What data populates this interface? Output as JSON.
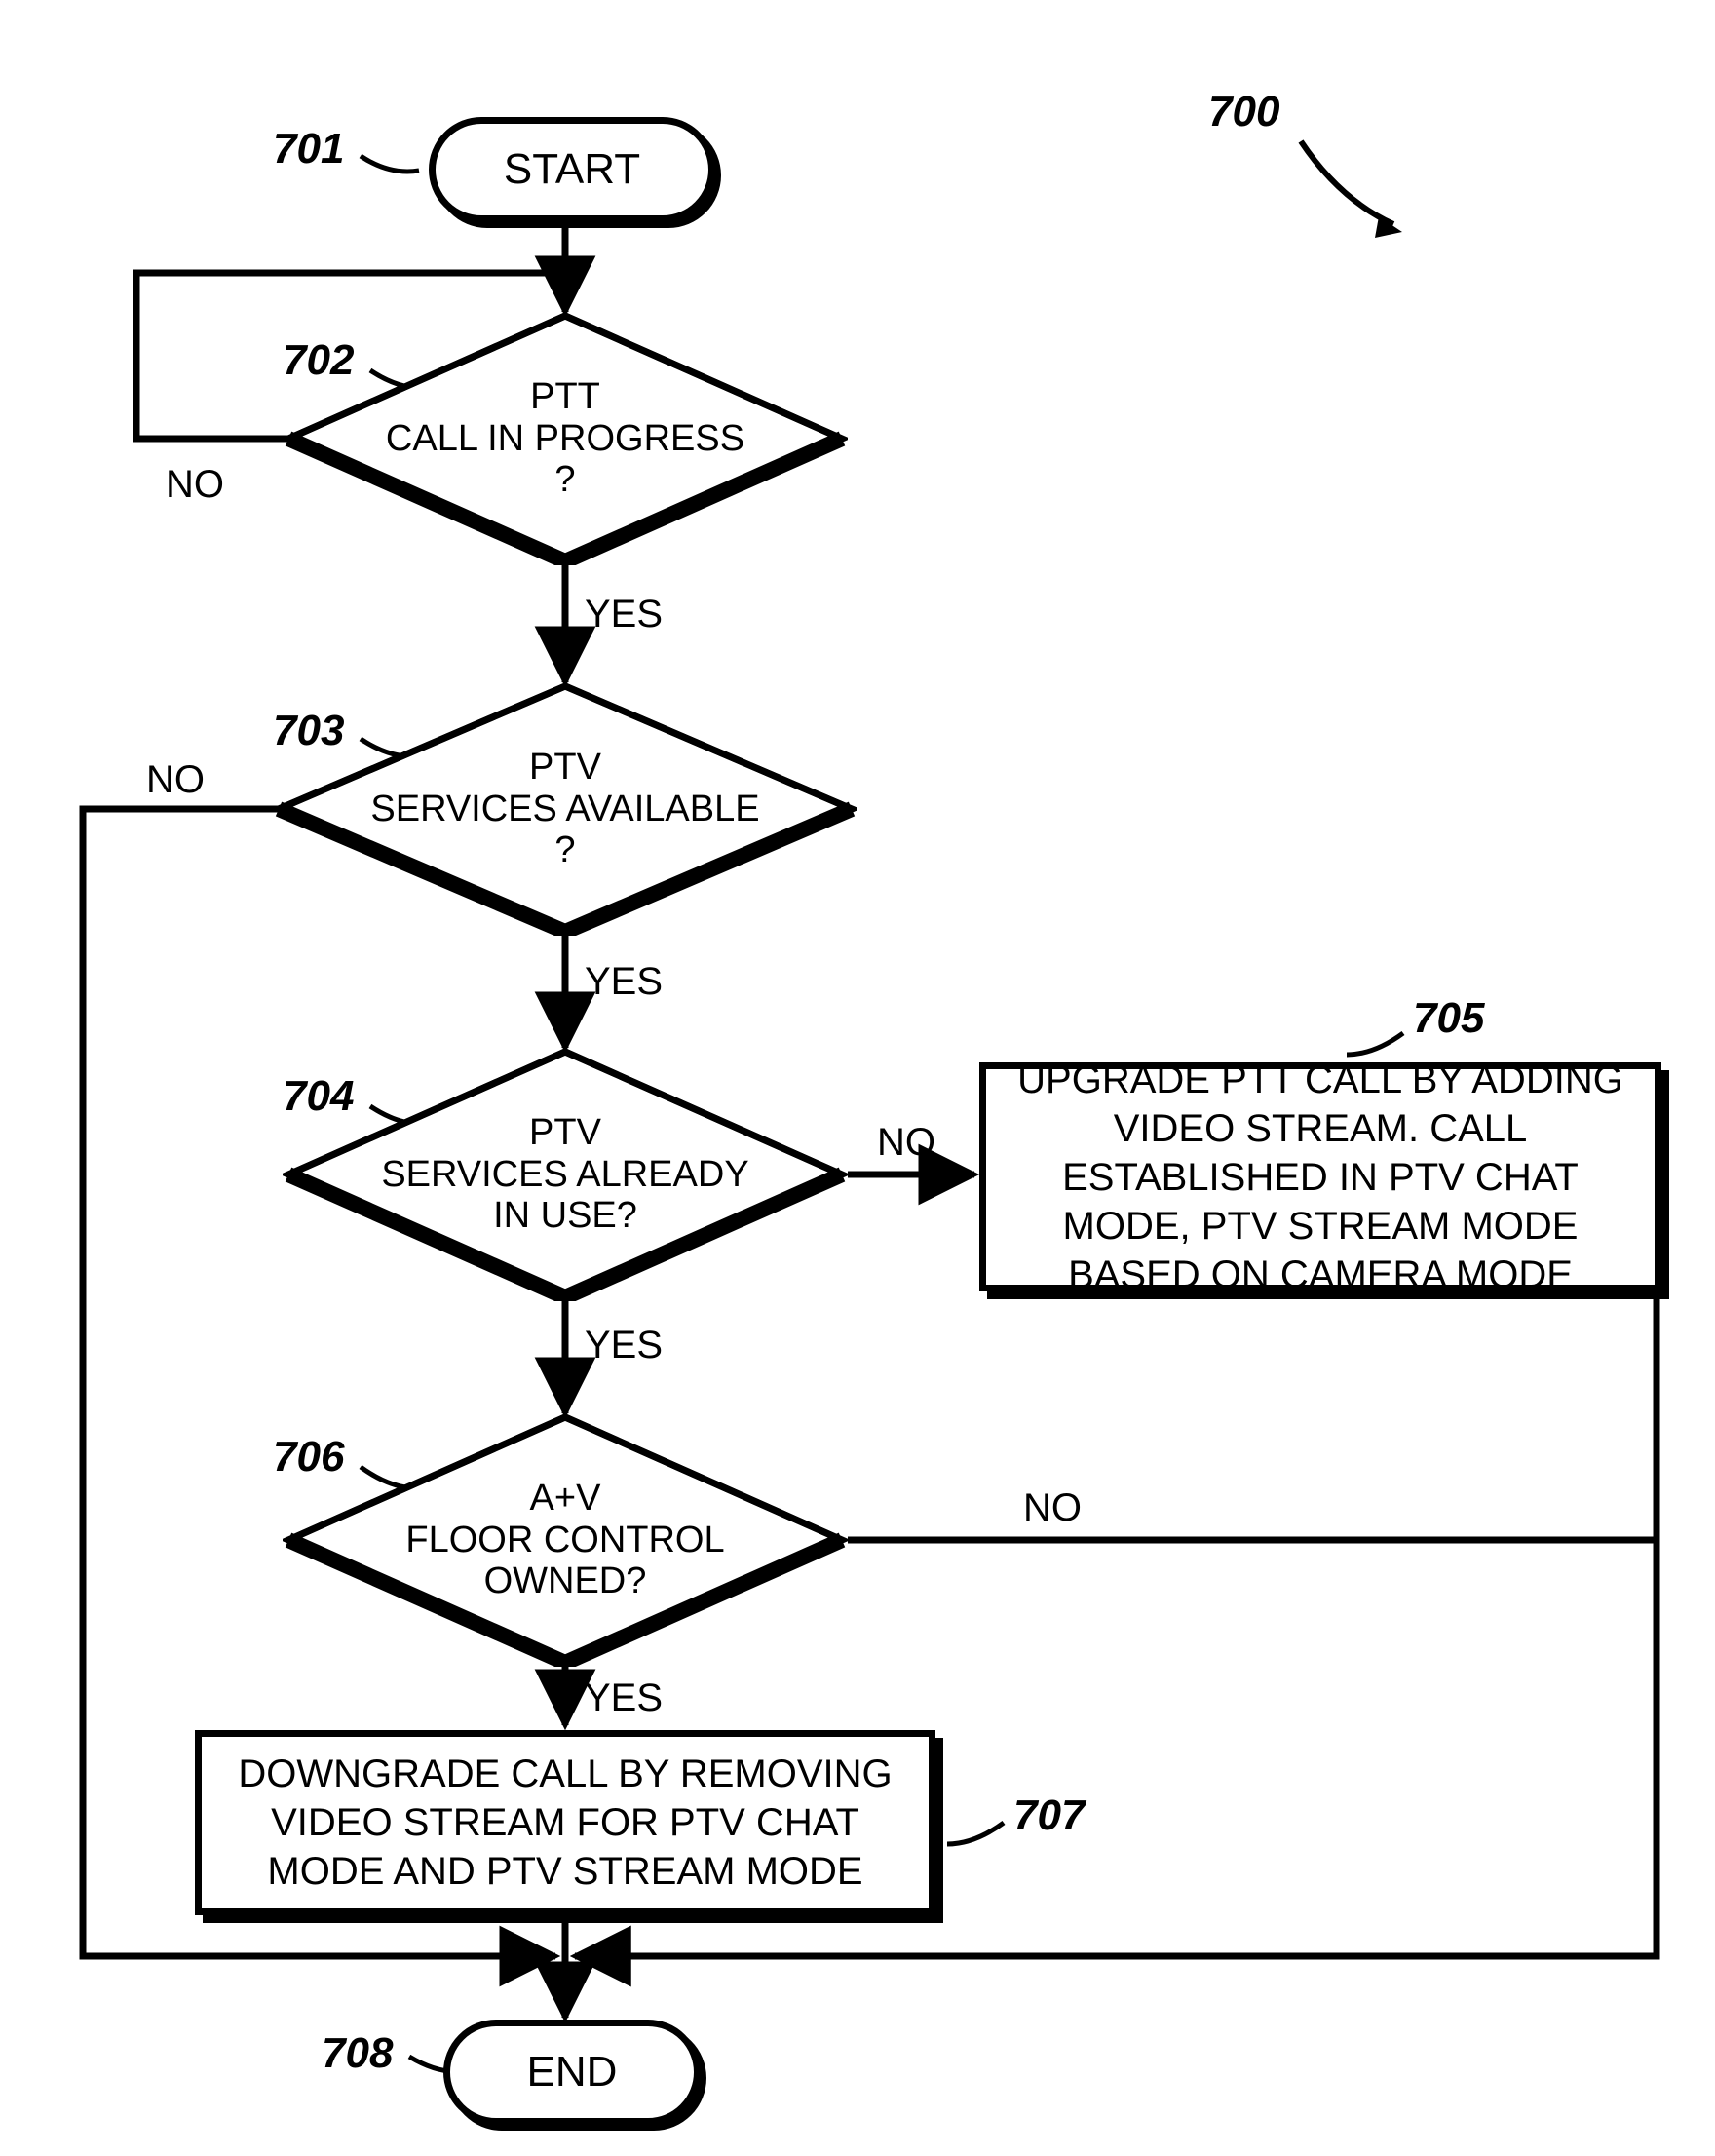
{
  "figure_ref": "700",
  "refs": {
    "r701": "701",
    "r702": "702",
    "r703": "703",
    "r704": "704",
    "r705": "705",
    "r706": "706",
    "r707": "707",
    "r708": "708"
  },
  "term": {
    "start": "START",
    "end": "END"
  },
  "decisions": {
    "d702": "PTT\nCALL IN PROGRESS\n?",
    "d703": "PTV\nSERVICES AVAILABLE\n?",
    "d704": "PTV\nSERVICES ALREADY\nIN USE?",
    "d706": "A+V\nFLOOR CONTROL\nOWNED?"
  },
  "process": {
    "p705": "UPGRADE PTT CALL BY ADDING VIDEO STREAM. CALL ESTABLISHED IN PTV CHAT MODE, PTV STREAM MODE BASED ON CAMERA MODE",
    "p707": "DOWNGRADE CALL BY REMOVING VIDEO STREAM FOR PTV CHAT MODE AND PTV STREAM MODE"
  },
  "labels": {
    "yes": "YES",
    "no": "NO"
  },
  "chart_data": {
    "type": "flowchart",
    "nodes": [
      {
        "id": "701",
        "type": "terminator",
        "text": "START"
      },
      {
        "id": "702",
        "type": "decision",
        "text": "PTT CALL IN PROGRESS?"
      },
      {
        "id": "703",
        "type": "decision",
        "text": "PTV SERVICES AVAILABLE?"
      },
      {
        "id": "704",
        "type": "decision",
        "text": "PTV SERVICES ALREADY IN USE?"
      },
      {
        "id": "705",
        "type": "process",
        "text": "UPGRADE PTT CALL BY ADDING VIDEO STREAM. CALL ESTABLISHED IN PTV CHAT MODE, PTV STREAM MODE BASED ON CAMERA MODE"
      },
      {
        "id": "706",
        "type": "decision",
        "text": "A+V FLOOR CONTROL OWNED?"
      },
      {
        "id": "707",
        "type": "process",
        "text": "DOWNGRADE CALL BY REMOVING VIDEO STREAM FOR PTV CHAT MODE AND PTV STREAM MODE"
      },
      {
        "id": "708",
        "type": "terminator",
        "text": "END"
      }
    ],
    "edges": [
      {
        "from": "701",
        "to": "702",
        "label": ""
      },
      {
        "from": "702",
        "to": "702",
        "label": "NO"
      },
      {
        "from": "702",
        "to": "703",
        "label": "YES"
      },
      {
        "from": "703",
        "to": "708",
        "label": "NO"
      },
      {
        "from": "703",
        "to": "704",
        "label": "YES"
      },
      {
        "from": "704",
        "to": "705",
        "label": "NO"
      },
      {
        "from": "704",
        "to": "706",
        "label": "YES"
      },
      {
        "from": "705",
        "to": "708",
        "label": ""
      },
      {
        "from": "706",
        "to": "708",
        "label": "NO"
      },
      {
        "from": "706",
        "to": "707",
        "label": "YES"
      },
      {
        "from": "707",
        "to": "708",
        "label": ""
      }
    ]
  }
}
